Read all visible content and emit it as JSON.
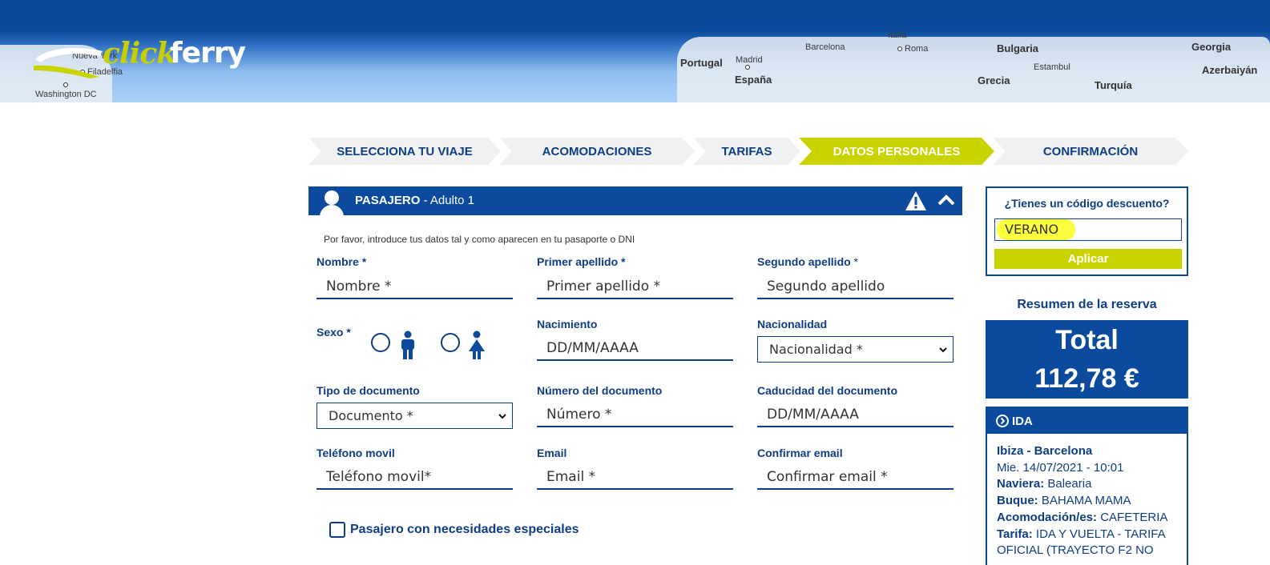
{
  "header": {
    "logo_click": "click",
    "logo_ferry": "ferry",
    "map_labels": [
      "Nueva York",
      "Filadelfia",
      "Washington DC",
      "Portugal",
      "Madrid",
      "España",
      "Barcelona",
      "Italia",
      "Roma",
      "Bulgaria",
      "Estambul",
      "Grecia",
      "Turquía",
      "Georgia",
      "Azerbaiyán"
    ]
  },
  "steps": [
    "SELECCIONA TU VIAJE",
    "ACOMODACIONES",
    "TARIFAS",
    "DATOS PERSONALES",
    "CONFIRMACIÓN"
  ],
  "active_step": "DATOS PERSONALES",
  "passenger": {
    "title_bold": "PASAJERO",
    "title_rest": " - Adulto 1",
    "hint": "Por favor, introduce tus datos tal y como aparecen en tu pasaporte o DNI",
    "fields": {
      "nombre": {
        "label": "Nombre *",
        "placeholder": "Nombre *"
      },
      "primer_apellido": {
        "label": "Primer apellido *",
        "placeholder": "Primer apellido *"
      },
      "segundo_apellido": {
        "label": "Segundo apellido",
        "label_suffix": " *",
        "placeholder": "Segundo apellido"
      },
      "sexo": {
        "label": "Sexo *"
      },
      "nacimiento": {
        "label": "Nacimiento",
        "placeholder": "DD/MM/AAAA"
      },
      "nacionalidad": {
        "label": "Nacionalidad",
        "selected": "Nacionalidad *"
      },
      "tipo_documento": {
        "label": "Tipo de documento",
        "selected": "Documento *"
      },
      "numero_documento": {
        "label": "Número del documento",
        "placeholder": "Número *"
      },
      "caducidad": {
        "label": "Caducidad del documento",
        "placeholder": "DD/MM/AAAA"
      },
      "telefono": {
        "label": "Teléfono movil",
        "placeholder": "Teléfono movil*"
      },
      "email": {
        "label": "Email",
        "placeholder": "Email *"
      },
      "confirmar_email": {
        "label": "Confirmar email",
        "placeholder": "Confirmar email *"
      }
    },
    "special_needs_label": "Pasajero con necesidades especiales"
  },
  "discount": {
    "title": "¿Tienes un código descuento?",
    "value": "VERANO",
    "button": "Aplicar",
    "highlight_color": "#fbff3d"
  },
  "summary": {
    "title": "Resumen de la reserva",
    "total_label": "Total",
    "total_value": "112,78 €"
  },
  "ida": {
    "title": "IDA",
    "route": "Ibiza - Barcelona",
    "date": "Mie. 14/07/2021 - 10:01",
    "naviera_label": "Naviera:",
    "naviera": " Balearia",
    "buque_label": "Buque:",
    "buque": " BAHAMA MAMA",
    "acomodacion_label": "Acomodación/es:",
    "acomodacion": " CAFETERIA",
    "tarifa_label": "Tarifa:",
    "tarifa": " IDA Y VUELTA - TARIFA OFICIAL (TRAYECTO F2 NO"
  },
  "colors": {
    "primary": "#0b4a9c",
    "accent": "#c9d300",
    "text": "#0f3d84"
  }
}
